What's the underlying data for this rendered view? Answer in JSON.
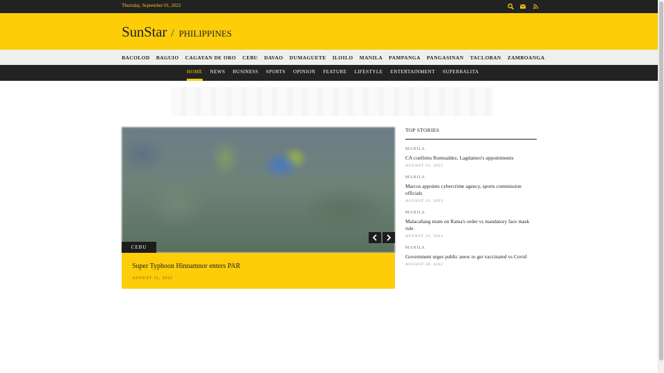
{
  "topbar": {
    "date": "Thursday, September 01, 2022",
    "icons": [
      "search-icon",
      "mail-icon",
      "rss-icon"
    ]
  },
  "header": {
    "logo": "SunStar",
    "separator": "/",
    "edition": "PHILIPPINES"
  },
  "cities": [
    "BACOLOD",
    "BAGUIO",
    "CAGAYAN DE ORO",
    "CEBU",
    "DAVAO",
    "DUMAGUETE",
    "ILOILO",
    "MANILA",
    "PAMPANGA",
    "PANGASINAN",
    "TACLOBAN",
    "ZAMBOANGA"
  ],
  "sections": [
    "HOME",
    "NEWS",
    "BUSINESS",
    "SPORTS",
    "OPINION",
    "FEATURE",
    "LIFESTYLE",
    "ENTERTAINMENT",
    "SUPERBALITA"
  ],
  "active_section": "HOME",
  "slider": {
    "tag": "CEBU",
    "title": "Super Typhoon Hinnamnor enters PAR",
    "date": "AUGUST 31, 2022"
  },
  "top_stories": {
    "heading": "TOP STORIES",
    "items": [
      {
        "category": "MANILA",
        "headline": "CA confirms Romualdez, Lagdameo's appointments",
        "date": "AUGUST 31, 2022"
      },
      {
        "category": "MANILA",
        "headline": "Marcos appoints cybercrime agency, sports commission officials",
        "date": "AUGUST 31, 2022"
      },
      {
        "category": "MANILA",
        "headline": "Malacañang mum on Rama's order vs mandatory face mask rule",
        "date": "AUGUST 31, 2022"
      },
      {
        "category": "MANILA",
        "headline": "Government urges public anew to get vaccinated vs Covid",
        "date": "AUGUST 30, 2022"
      }
    ]
  },
  "colors": {
    "brand_yellow": "#fdcd0a",
    "dark": "#222222"
  }
}
